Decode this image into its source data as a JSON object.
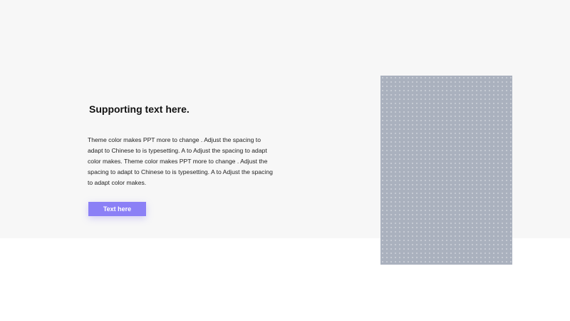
{
  "slide": {
    "headline": "Supporting text here.",
    "body": "Theme  color makes PPT more to change . Adjust the spacing to adapt to Chinese to is typesetting. A to Adjust the spacing to adapt color makes. Theme  color makes PPT more to change . Adjust the spacing to adapt to Chinese to is typesetting. A to Adjust the spacing to adapt color makes.",
    "button_label": "Text here"
  },
  "colors": {
    "accent": "#8b80f6",
    "band_background": "#f7f7f7",
    "image_placeholder": "#aab1be"
  }
}
